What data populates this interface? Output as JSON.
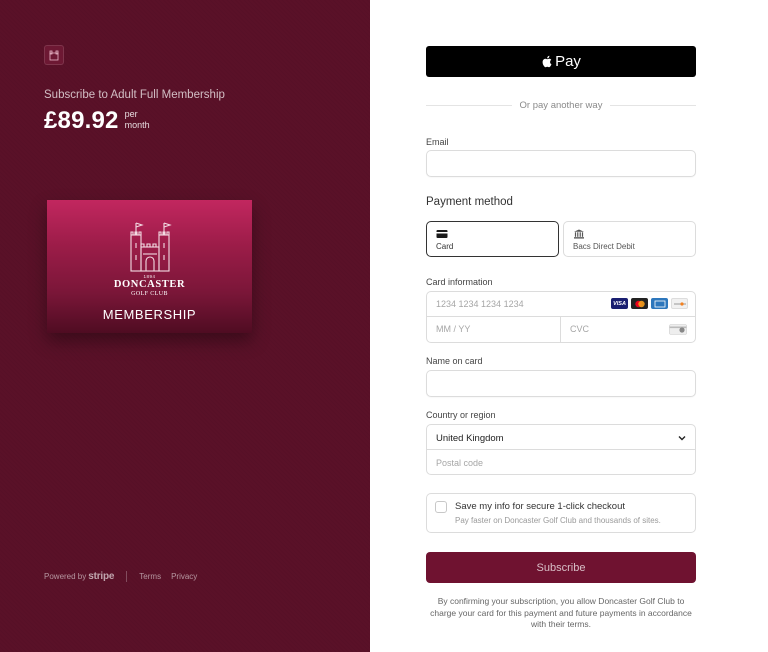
{
  "merchant": {
    "subscribe_title": "Subscribe to Adult Full Membership",
    "price": "£89.92",
    "per_line1": "per",
    "per_line2": "month"
  },
  "product_card": {
    "est": "1894",
    "club_name": "DONCASTER",
    "club_sub": "GOLF CLUB",
    "label": "MEMBERSHIP"
  },
  "footer": {
    "powered_by": "Powered by",
    "brand": "stripe",
    "terms": "Terms",
    "privacy": "Privacy"
  },
  "apple_pay": {
    "apple_glyph": "",
    "label": "Pay"
  },
  "divider_text": "Or pay another way",
  "email": {
    "label": "Email",
    "value": ""
  },
  "payment_method": {
    "title": "Payment method",
    "options": [
      {
        "label": "Card",
        "selected": true,
        "icon": "card-icon"
      },
      {
        "label": "Bacs Direct Debit",
        "selected": false,
        "icon": "bank-icon"
      }
    ]
  },
  "card_info": {
    "label": "Card information",
    "number_placeholder": "1234 1234 1234 1234",
    "expiry_placeholder": "MM / YY",
    "cvc_placeholder": "CVC",
    "brands": [
      "VISA",
      "mastercard",
      "AMEX",
      "DISCOVER"
    ]
  },
  "name_on_card": {
    "label": "Name on card",
    "value": ""
  },
  "country": {
    "label": "Country or region",
    "selected": "United Kingdom",
    "postal_placeholder": "Postal code"
  },
  "save_info": {
    "title": "Save my info for secure 1-click checkout",
    "subtitle": "Pay faster on Doncaster Golf Club and thousands of sites."
  },
  "subscribe_button": "Subscribe",
  "legal_text": "By confirming your subscription, you allow Doncaster Golf Club to charge your card for this payment and future payments in accordance with their terms.",
  "colors": {
    "left_bg": "#5a1128",
    "subscribe_button": "#6f1230",
    "apple_pay_bg": "#000000"
  }
}
